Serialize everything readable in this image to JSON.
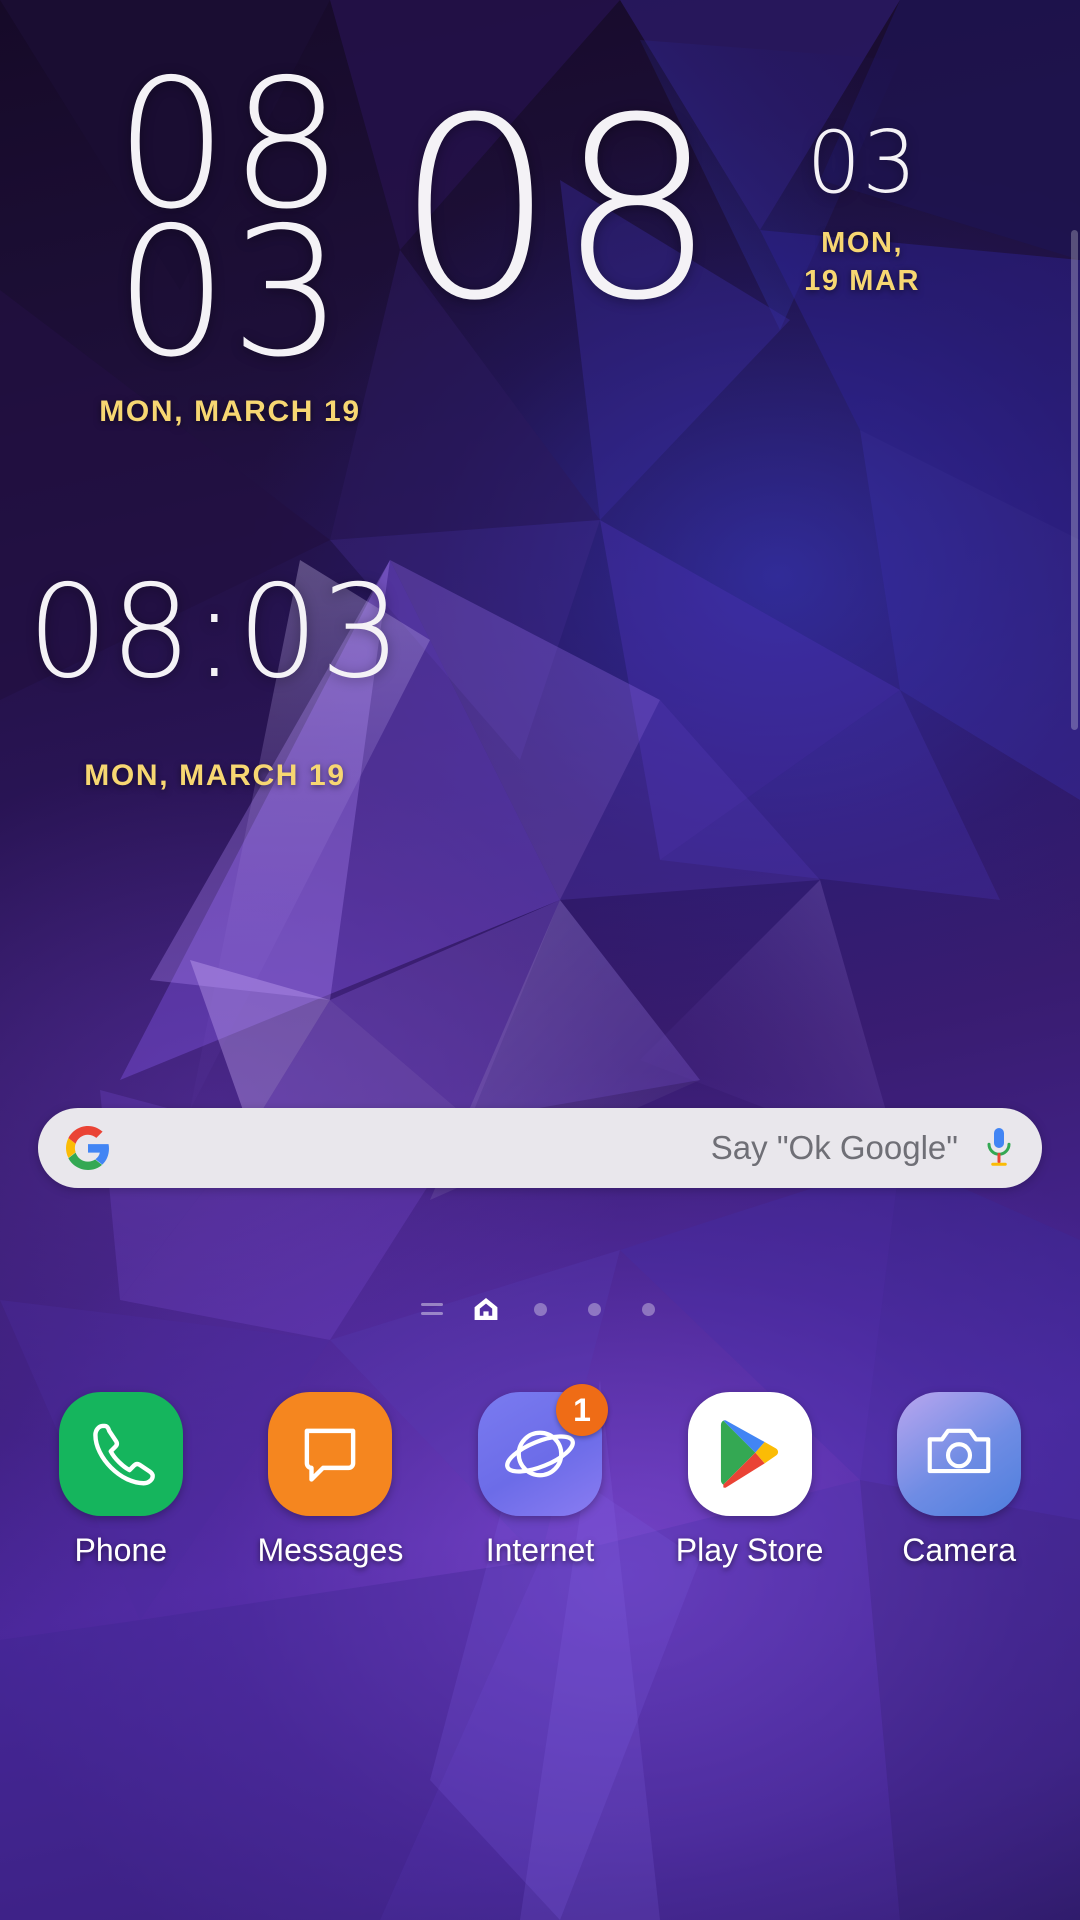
{
  "wallpaper": {
    "description": "low-poly purple-blue geometric",
    "base_color": "#3a1d74",
    "accent_color": "#8a5cf0"
  },
  "widgets": {
    "clock_stacked": {
      "hours": "08",
      "minutes": "03",
      "date": "MON, MARCH 19"
    },
    "clock_big": {
      "hours": "08",
      "minutes": "03",
      "date_line1": "MON,",
      "date_line2": "19 MAR"
    },
    "clock_inline": {
      "time": "08:03",
      "date": "MON, MARCH 19"
    }
  },
  "colors": {
    "clock_text": "#f4f2f6",
    "date_text": "#f7d772",
    "badge": "#ef6c16",
    "search_bar_bg": "#e9e7ec",
    "search_hint": "#6f6f76"
  },
  "search": {
    "logo_icon": "google-g-icon",
    "hint": "Say \"Ok Google\"",
    "mic_icon": "microphone-icon"
  },
  "page_indicator": {
    "items": [
      {
        "icon": "bixby-lines-icon",
        "active": false
      },
      {
        "icon": "home-house-icon",
        "active": true
      },
      {
        "icon": "page-dot-icon",
        "active": false
      },
      {
        "icon": "page-dot-icon",
        "active": false
      },
      {
        "icon": "page-dot-icon",
        "active": false
      }
    ]
  },
  "dock": {
    "apps": [
      {
        "label": "Phone",
        "icon": "phone-handset-icon",
        "badge": ""
      },
      {
        "label": "Messages",
        "icon": "message-bubble-icon",
        "badge": ""
      },
      {
        "label": "Internet",
        "icon": "internet-planet-icon",
        "badge": "1"
      },
      {
        "label": "Play Store",
        "icon": "play-store-icon",
        "badge": ""
      },
      {
        "label": "Camera",
        "icon": "camera-icon",
        "badge": ""
      }
    ]
  }
}
